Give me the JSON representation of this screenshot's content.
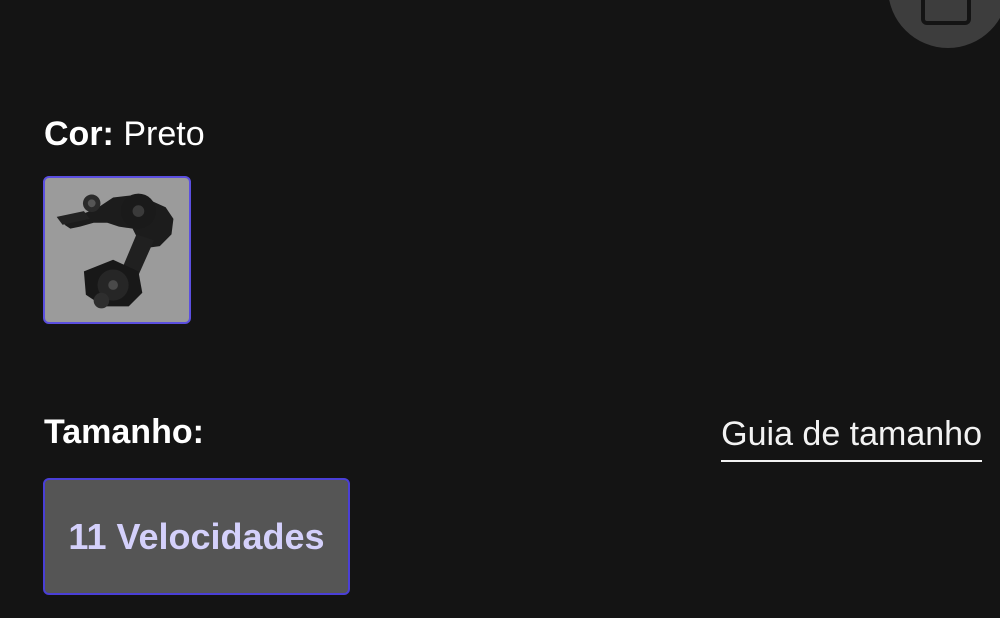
{
  "colors": {
    "background": "#141414",
    "accent": "#5b4fe0",
    "option_text": "#d4d0fb",
    "option_background": "#555555",
    "fab_background": "#3d3d3d"
  },
  "top_action": {
    "icon": "box-icon"
  },
  "color_section": {
    "label": "Cor:",
    "value": "Preto",
    "swatches": [
      {
        "image": "rear-derailleur-black",
        "selected": true
      }
    ]
  },
  "size_section": {
    "label": "Tamanho:",
    "guide_link": "Guia de tamanho",
    "options": [
      {
        "label": "11 Velocidades",
        "selected": true
      }
    ]
  }
}
